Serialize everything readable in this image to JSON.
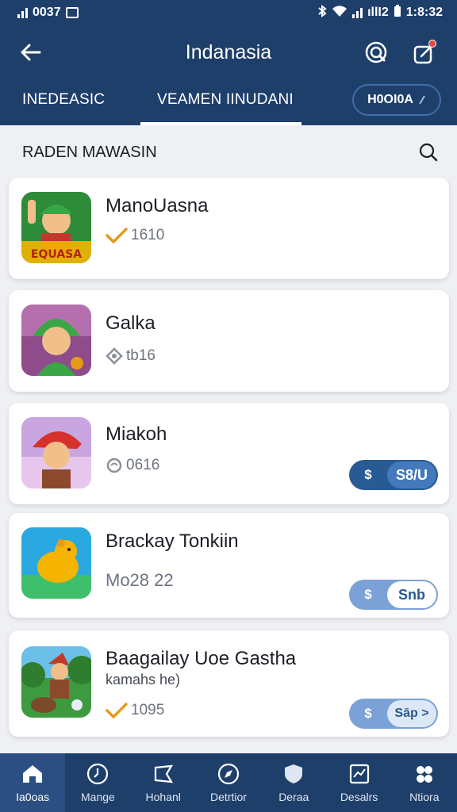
{
  "status_bar": {
    "left_text": "0037",
    "time": "1:8:32",
    "right_text": "ıllI2"
  },
  "app_bar": {
    "title": "Indanasia"
  },
  "tabs": [
    {
      "label": "INEDEASIC"
    },
    {
      "label": "VEAMEN IINUDANI"
    },
    {
      "label": "H0OI0A"
    }
  ],
  "section": {
    "title": "RADEN MAWASIN"
  },
  "apps": [
    {
      "name": "ManoUasna",
      "meta": "1610",
      "meta_icon": "check-icon",
      "icon_text": "EQUASA",
      "icon_theme": "green-warrior"
    },
    {
      "name": "Galka",
      "meta": "tb16",
      "meta_icon": "tag-icon",
      "icon_theme": "green-hood"
    },
    {
      "name": "Miakoh",
      "meta": "0616",
      "meta_icon": "refresh-icon",
      "icon_theme": "red-cap",
      "toggle": {
        "left": "$",
        "right": "S8/U"
      }
    },
    {
      "name": "Brackay Tonkiin",
      "meta": "Mo28  22",
      "icon_theme": "yellow-bear",
      "toggle": {
        "left": "$",
        "right": "Snb"
      }
    },
    {
      "name": "Baagailay Uoe Gastha",
      "meta_sub": "kamahs he)",
      "meta": "1095",
      "meta_icon": "check-icon",
      "icon_theme": "forest-hunter",
      "toggle": {
        "left": "$",
        "right": "Sāp >"
      }
    }
  ],
  "bottom_nav": [
    {
      "label": "Ia0oas",
      "icon": "home-icon",
      "active": true
    },
    {
      "label": "Mange",
      "icon": "clock-icon"
    },
    {
      "label": "Hohanl",
      "icon": "flag-icon"
    },
    {
      "label": "Detrtior",
      "icon": "compass-icon"
    },
    {
      "label": "Deraa",
      "icon": "shield-icon"
    },
    {
      "label": "Desalrs",
      "icon": "chart-icon"
    },
    {
      "label": "Ntiora",
      "icon": "people-icon"
    }
  ],
  "colors": {
    "header_bg": "#1f3f6b",
    "page_bg": "#eef0f4",
    "toggle_blue": "#285a93",
    "check_orange": "#e59a1a"
  }
}
